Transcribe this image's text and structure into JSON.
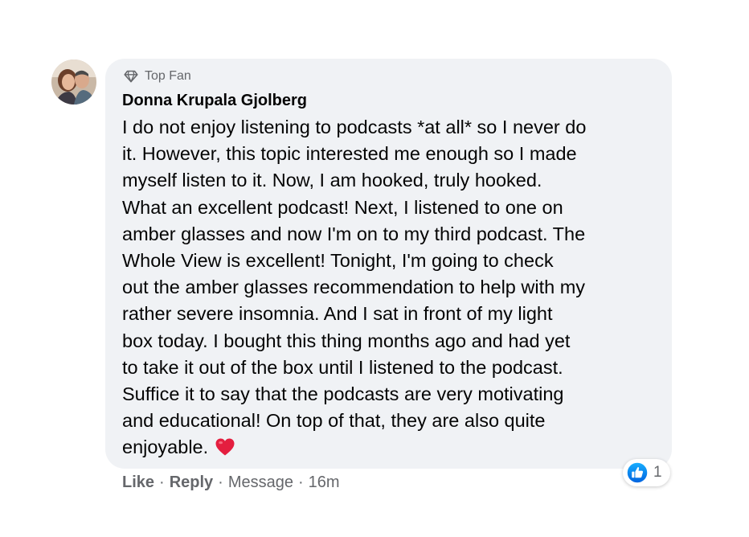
{
  "comment": {
    "badge_label": "Top Fan",
    "author_name": "Donna Krupala Gjolberg",
    "text": "I do not enjoy listening to podcasts *at all* so I never do\nit. However, this topic interested me enough so I made\nmyself listen to it. Now, I am hooked, truly hooked.\nWhat an excellent podcast! Next, I listened to one on\namber glasses and now I'm on to my third podcast. The\nWhole View is excellent! Tonight, I'm going to check\nout the amber glasses recommendation to help with my\nrather severe insomnia. And I sat in front of my light\nbox today. I bought this thing months ago and had yet\nto take it out of the box until I listened to the podcast.\nSuffice it to say that the podcasts are very motivating\nand educational! On top of that, they are also quite\nenjoyable.",
    "emoji_icon": "red-heart-icon"
  },
  "reactions": {
    "icon": "like-icon",
    "count": "1"
  },
  "actions": {
    "like_label": "Like",
    "reply_label": "Reply",
    "message_label": "Message",
    "separator": "·",
    "timestamp": "16m"
  },
  "colors": {
    "bubble_bg": "#f0f2f5",
    "text_primary": "#050505",
    "text_secondary": "#65676b",
    "like_blue": "#1877f2",
    "heart_red": "#e41e3f"
  }
}
